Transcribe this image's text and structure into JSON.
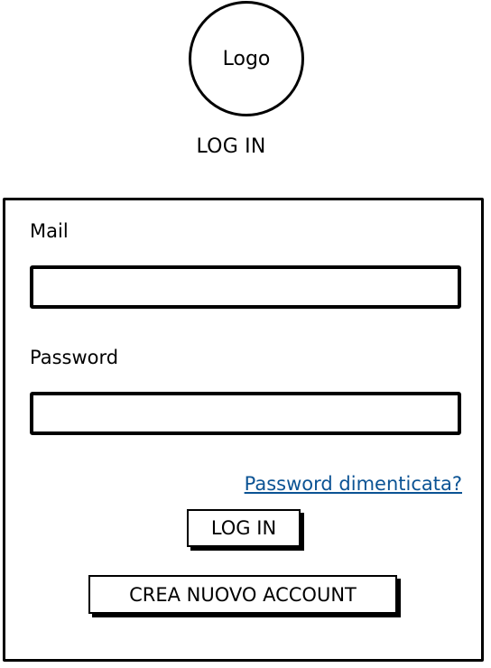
{
  "header": {
    "logo_text": "Logo",
    "title": "LOG IN"
  },
  "form": {
    "mail_label": "Mail",
    "mail_value": "",
    "password_label": "Password",
    "password_value": "",
    "forgot_password_link": "Password dimenticata?",
    "login_button": "LOG IN",
    "create_account_button": "CREA NUOVO ACCOUNT",
    "link_color": "#0b5394"
  }
}
